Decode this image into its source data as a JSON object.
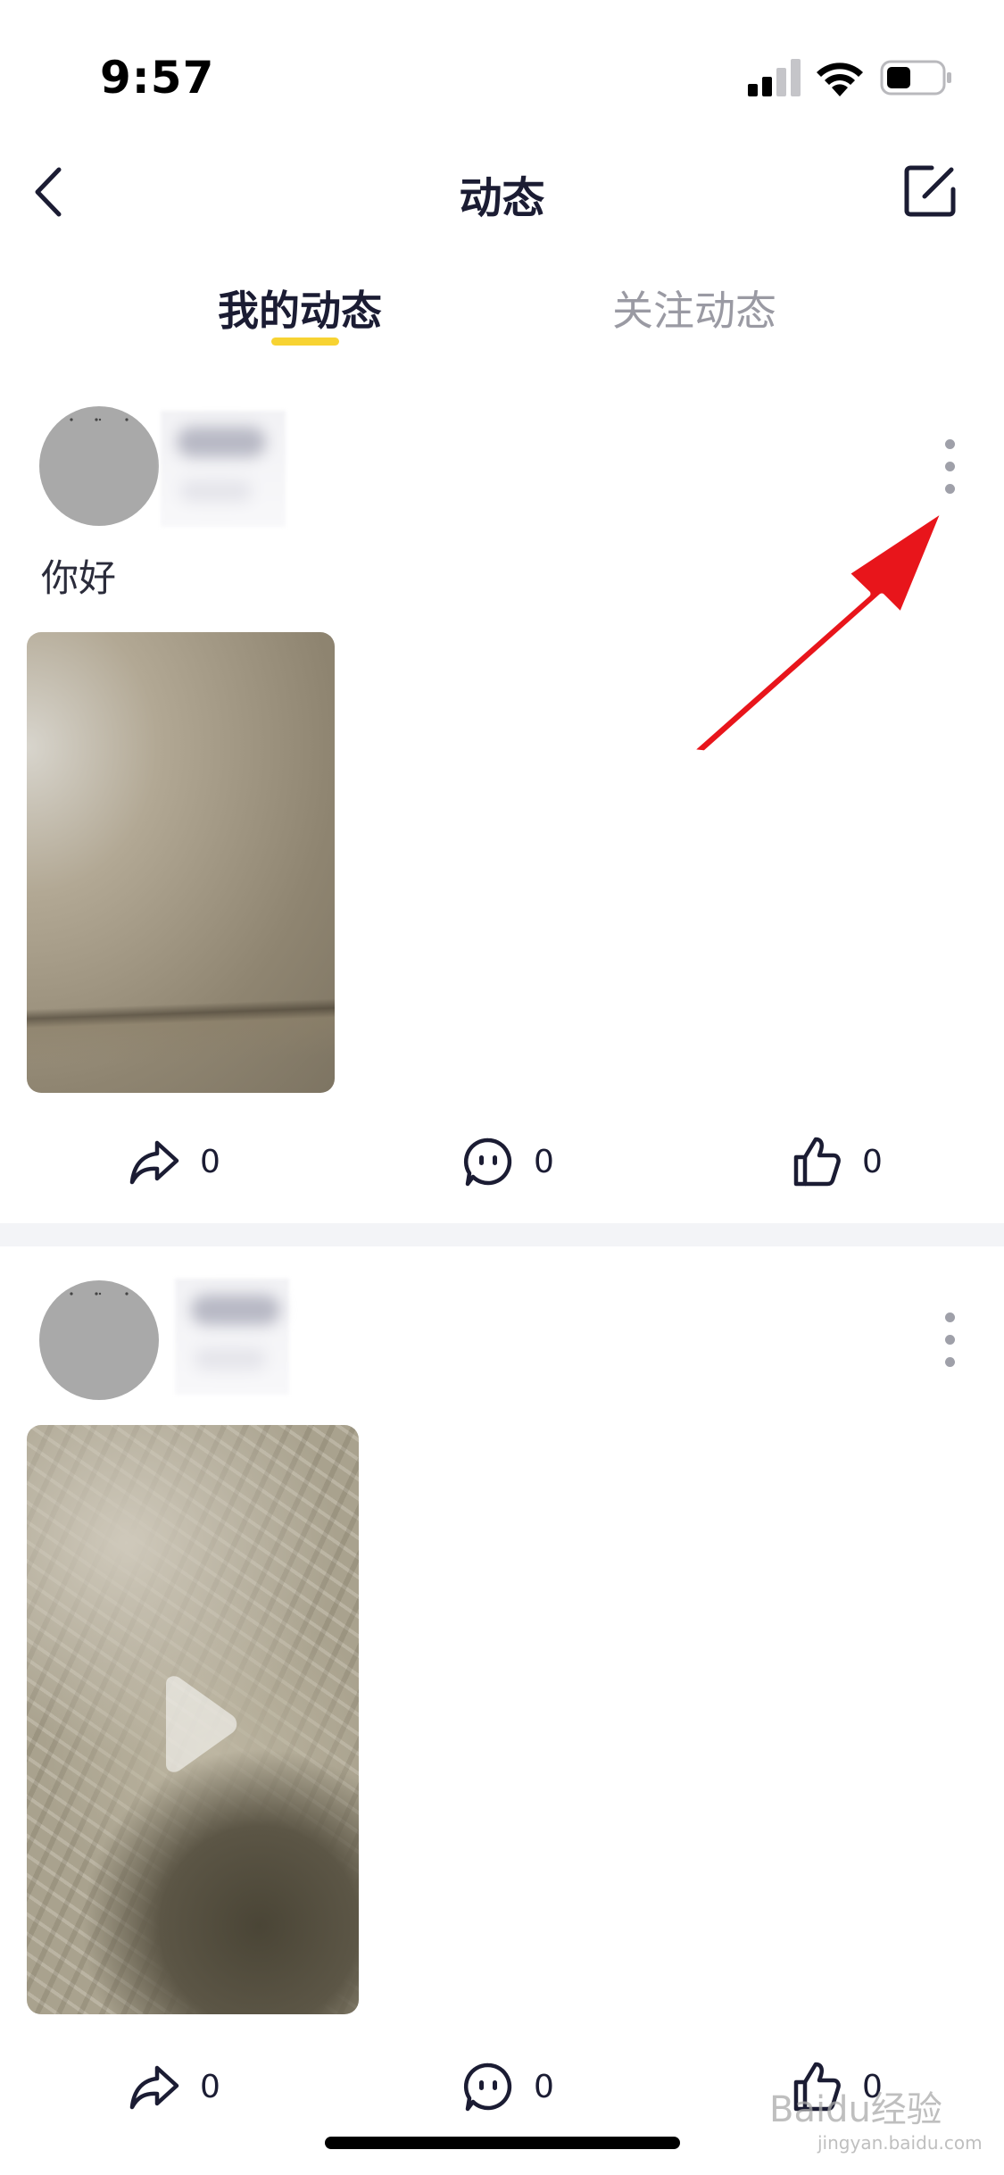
{
  "status_bar": {
    "time": "9:57"
  },
  "nav": {
    "title": "动态",
    "back_icon": "chevron-left-icon",
    "edit_icon": "edit-square-icon"
  },
  "tabs": [
    {
      "label": "我的动态",
      "active": true
    },
    {
      "label": "关注动态",
      "active": false
    }
  ],
  "colors": {
    "tab_underline": "#f7d332",
    "annotation_arrow": "#e8151b",
    "text_primary": "#1b1c33",
    "text_muted": "#9a9aa3"
  },
  "posts": [
    {
      "text": "你好",
      "media": "photo",
      "actions": {
        "share_count": "0",
        "comment_count": "0",
        "like_count": "0"
      }
    },
    {
      "text": "",
      "media": "video",
      "actions": {
        "share_count": "0",
        "comment_count": "0",
        "like_count": "0"
      }
    }
  ],
  "watermark": {
    "brand": "Baidu经验",
    "url": "jingyan.baidu.com"
  }
}
